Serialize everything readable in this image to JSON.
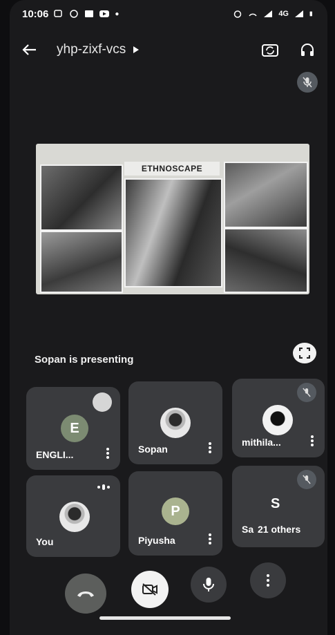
{
  "status_bar": {
    "time": "10:06",
    "network": "4G"
  },
  "header": {
    "meeting_code": "yhp-zixf-vcs"
  },
  "presentation": {
    "slide_heading": "ETHNOSCAPE",
    "presenter_label": "Sopan is presenting"
  },
  "participants": [
    {
      "name": "ENGLI...",
      "initial": "E",
      "avatar": "letter",
      "muted": false
    },
    {
      "name": "Sopan",
      "initial": "",
      "avatar": "photo",
      "muted": false
    },
    {
      "name": "mithila...",
      "initial": "",
      "avatar": "photo",
      "muted": true
    },
    {
      "name": "You",
      "initial": "",
      "avatar": "photo",
      "muted": false
    },
    {
      "name": "Piyusha",
      "initial": "P",
      "avatar": "letter",
      "muted": false
    },
    {
      "name": "Sa",
      "initial": "S",
      "avatar": "letter",
      "muted": true,
      "others": "21 others"
    }
  ],
  "colors": {
    "background": "#1a1a1c",
    "tile": "#3a3b3e",
    "end_call": "#5c5e5c",
    "camera_off_button": "#f2f2f2"
  },
  "icons": [
    "back-arrow-icon",
    "switch-camera-icon",
    "audio-output-icon",
    "mic-off-icon",
    "fullscreen-icon",
    "more-vert-icon",
    "end-call-icon",
    "camera-off-icon",
    "mic-icon",
    "speaking-indicator-icon"
  ]
}
